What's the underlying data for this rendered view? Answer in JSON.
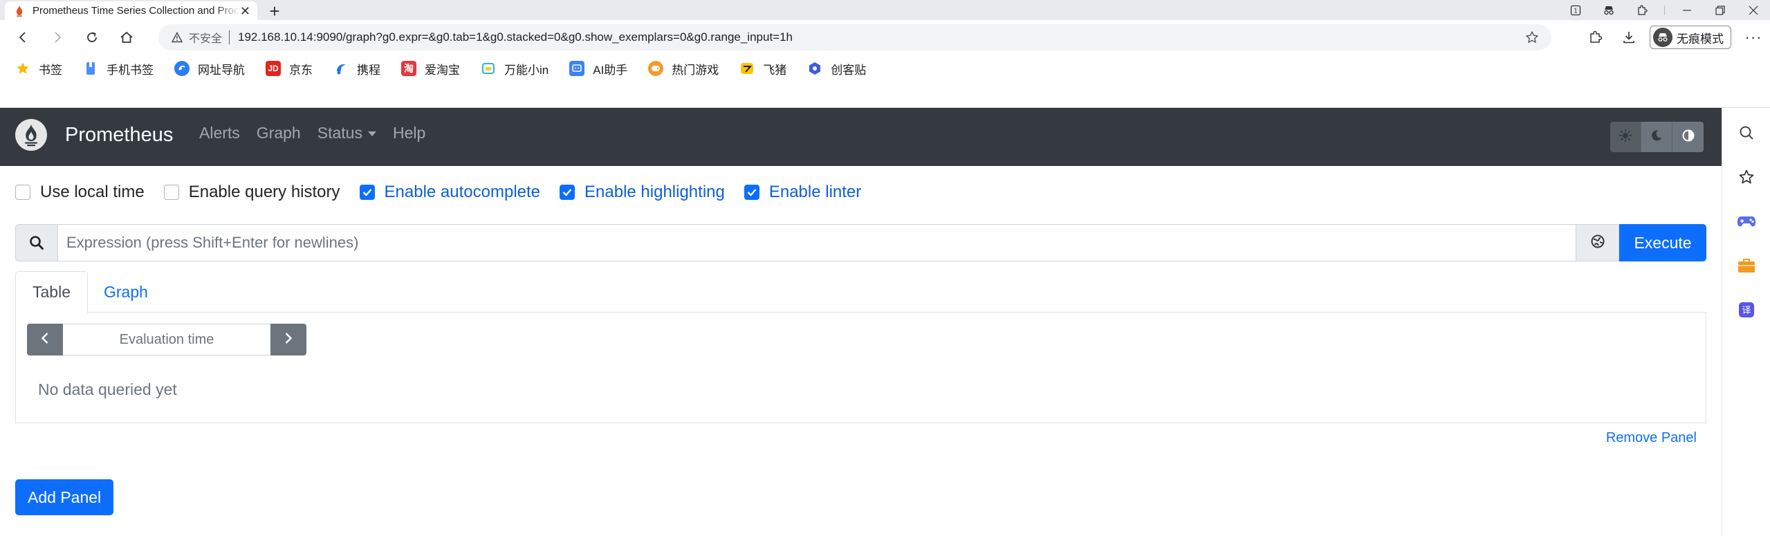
{
  "browser": {
    "tab": {
      "title": "Prometheus Time Series Collection and Processing Server",
      "favicon": "prometheus-favicon"
    },
    "address": {
      "security_label": "不安全",
      "url": "192.168.10.14:9090/graph?g0.expr=&g0.tab=1&g0.stacked=0&g0.show_exemplars=0&g0.range_input=1h"
    },
    "incognito_label": "无痕模式",
    "bookmarks": [
      {
        "label": "书签",
        "icon": "star-icon",
        "color": "#f6b800"
      },
      {
        "label": "手机书签",
        "icon": "phone-bookmark-icon",
        "color": "#4f8ef7"
      },
      {
        "label": "网址导航",
        "icon": "navigation-icon",
        "color": "#2b7cf6"
      },
      {
        "label": "京东",
        "icon": "jd-icon",
        "color": "#e1251b",
        "glyph": "JD"
      },
      {
        "label": "携程",
        "icon": "ctrip-icon",
        "color": "#2577e3"
      },
      {
        "label": "爱淘宝",
        "icon": "taobao-icon",
        "color": "#e4393c",
        "glyph": "淘"
      },
      {
        "label": "万能小in",
        "icon": "wannengxiaoin-icon",
        "color": "#29b6c6"
      },
      {
        "label": "AI助手",
        "icon": "ai-assistant-icon",
        "color": "#3b82f6"
      },
      {
        "label": "热门游戏",
        "icon": "games-icon",
        "color": "#f39a2c"
      },
      {
        "label": "飞猪",
        "icon": "fliggy-icon",
        "color": "#ffc400"
      },
      {
        "label": "创客贴",
        "icon": "chuangketie-icon",
        "color": "#3c5ce0"
      }
    ]
  },
  "app": {
    "brand": "Prometheus",
    "nav": {
      "alerts": "Alerts",
      "graph": "Graph",
      "status": "Status",
      "help": "Help"
    },
    "options": {
      "local_time": {
        "label": "Use local time",
        "checked": false
      },
      "query_history": {
        "label": "Enable query history",
        "checked": false
      },
      "autocomplete": {
        "label": "Enable autocomplete",
        "checked": true
      },
      "highlighting": {
        "label": "Enable highlighting",
        "checked": true
      },
      "linter": {
        "label": "Enable linter",
        "checked": true
      }
    },
    "expression": {
      "placeholder": "Expression (press Shift+Enter for newlines)",
      "value": ""
    },
    "execute_label": "Execute",
    "panel": {
      "tabs": {
        "table": "Table",
        "graph": "Graph"
      },
      "active_tab": "Table",
      "eval_placeholder": "Evaluation time",
      "no_data": "No data queried yet",
      "remove_label": "Remove Panel"
    },
    "add_panel_label": "Add Panel",
    "colors": {
      "navbar": "#343a40",
      "primary": "#0d6efd"
    }
  }
}
